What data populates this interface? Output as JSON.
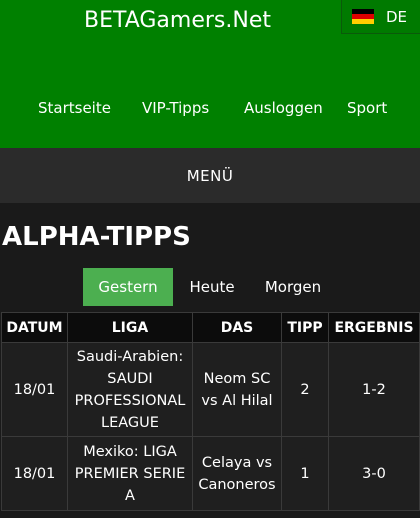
{
  "header": {
    "brand": "BETAGamers.Net",
    "language": "DE",
    "flag_colors": [
      "#000000",
      "#dd0000",
      "#ffce00"
    ],
    "nav": [
      "Startseite",
      "VIP-Tipps",
      "Ausloggen",
      "Sport"
    ]
  },
  "menu": {
    "label": "MENÜ"
  },
  "page": {
    "title": "ALPHA-TIPPS"
  },
  "tabs": [
    {
      "label": "Gestern",
      "active": true
    },
    {
      "label": "Heute",
      "active": false
    },
    {
      "label": "Morgen",
      "active": false
    }
  ],
  "table": {
    "headers": [
      "DATUM",
      "LIGA",
      "DAS",
      "TIPP",
      "ERGEBNIS"
    ],
    "rows": [
      {
        "date": "18/01",
        "league": "Saudi-Arabien: SAUDI PROFESSIONAL LEAGUE",
        "match": "Neom SC vs Al Hilal",
        "tip": "2",
        "result": "1-2"
      },
      {
        "date": "18/01",
        "league": "Mexiko: LIGA PREMIER SERIE A",
        "match": "Celaya vs Canoneros",
        "tip": "1",
        "result": "3-0"
      }
    ]
  },
  "colors": {
    "header_bg": "#008000",
    "active_tab": "#4caf50",
    "menu_bg": "#2b2b2b",
    "page_bg": "#1a1a1a"
  }
}
